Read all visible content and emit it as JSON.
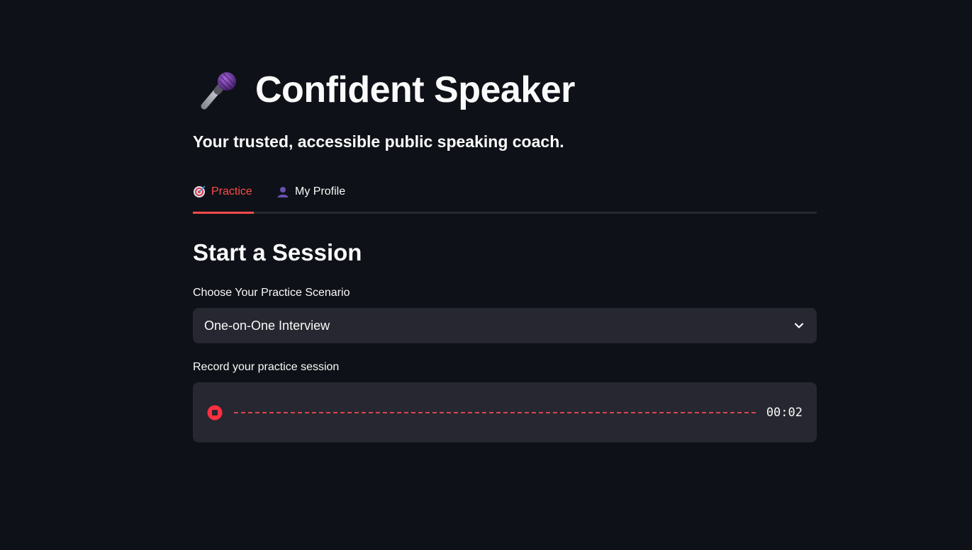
{
  "header": {
    "title": "Confident Speaker",
    "subtitle": "Your trusted, accessible public speaking coach.",
    "title_icon": "microphone-icon"
  },
  "tabs": [
    {
      "label": "Practice",
      "icon": "target-icon",
      "active": true
    },
    {
      "label": "My Profile",
      "icon": "person-icon",
      "active": false
    }
  ],
  "session": {
    "heading": "Start a Session",
    "scenario_label": "Choose Your Practice Scenario",
    "scenario_value": "One-on-One Interview",
    "record_label": "Record your practice session",
    "timer": "00:02"
  },
  "colors": {
    "background": "#0e1117",
    "surface": "#262730",
    "accent": "#ff4b4b",
    "text": "#fafafa"
  }
}
